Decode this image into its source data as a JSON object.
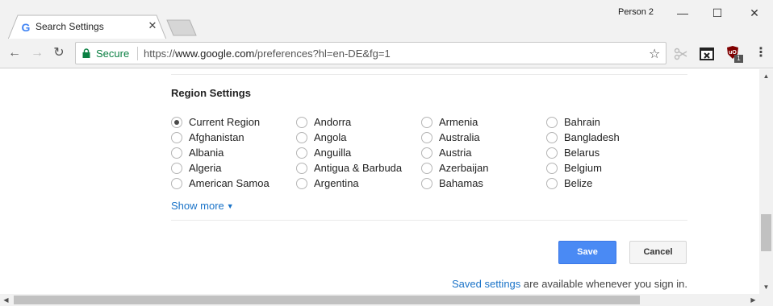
{
  "browser": {
    "tab": {
      "favicon": "google-g-icon",
      "title": "Search Settings",
      "close_glyph": "✕"
    },
    "profile_name": "Person 2",
    "window_controls": {
      "minimize": "—",
      "maximize": "☐",
      "close": "✕"
    },
    "toolbar": {
      "back_glyph": "←",
      "forward_glyph": "→",
      "reload_glyph": "↻",
      "secure_label": "Secure",
      "url_scheme": "https://",
      "url_host": "www.google.com",
      "url_path": "/preferences?hl=en-DE&fg=1",
      "star_glyph": "☆",
      "menu_glyph": "⋮",
      "ublock_badge": "1"
    }
  },
  "settings": {
    "section_title": "Region Settings",
    "regions": [
      [
        "Current Region",
        "Afghanistan",
        "Albania",
        "Algeria",
        "American Samoa"
      ],
      [
        "Andorra",
        "Angola",
        "Anguilla",
        "Antigua & Barbuda",
        "Argentina"
      ],
      [
        "Armenia",
        "Australia",
        "Austria",
        "Azerbaijan",
        "Bahamas"
      ],
      [
        "Bahrain",
        "Bangladesh",
        "Belarus",
        "Belgium",
        "Belize"
      ]
    ],
    "selected_region": "Current Region",
    "show_more_label": "Show more",
    "save_label": "Save",
    "cancel_label": "Cancel",
    "saved_settings_link": "Saved settings",
    "saved_settings_rest": " are available whenever you sign in."
  },
  "colors": {
    "accent_blue": "#4a8af4",
    "link_blue": "#1a73c8",
    "secure_green": "#0b8043"
  }
}
